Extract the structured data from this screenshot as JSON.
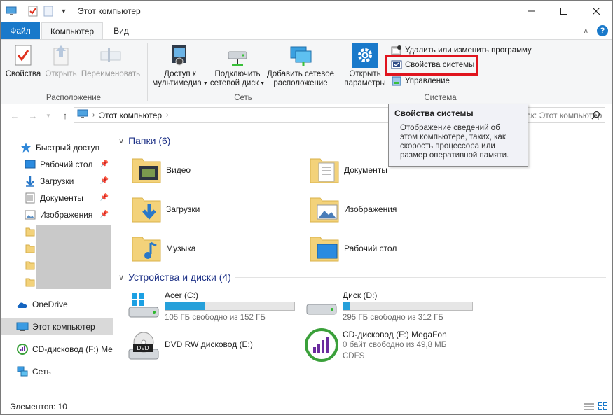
{
  "window": {
    "title": "Этот компьютер"
  },
  "tabs": {
    "file": "Файл",
    "computer": "Компьютер",
    "view": "Вид"
  },
  "ribbon": {
    "location": {
      "label": "Расположение",
      "properties": "Свойства",
      "open": "Открыть",
      "rename": "Переименовать"
    },
    "network": {
      "label": "Сеть",
      "media_line1": "Доступ к",
      "media_line2": "мультимедиа",
      "map_line1": "Подключить",
      "map_line2": "сетевой диск",
      "add_line1": "Добавить сетевое",
      "add_line2": "расположение"
    },
    "system": {
      "label": "Система",
      "open_line1": "Открыть",
      "open_line2": "параметры",
      "uninstall": "Удалить или изменить программу",
      "sysprops": "Свойства системы",
      "manage": "Управление"
    }
  },
  "address": {
    "path": "Этот компьютер",
    "search_placeholder": "рск: Этот компьютер"
  },
  "tooltip": {
    "title": "Свойства системы",
    "body_line1": "Отображение сведений об",
    "body_line2": "этом компьютере, таких, как",
    "body_line3": "скорость процессора или",
    "body_line4": "размер оперативной памяти."
  },
  "navpane": {
    "quick_access": "Быстрый доступ",
    "desktop": "Рабочий стол",
    "downloads": "Загрузки",
    "documents": "Документы",
    "pictures": "Изображения",
    "onedrive": "OneDrive",
    "this_pc": "Этот компьютер",
    "cd_drive": "CD-дисковод (F:) Me",
    "network": "Сеть"
  },
  "folders": {
    "header": "Папки (6)",
    "video": "Видео",
    "documents": "Документы",
    "downloads": "Загрузки",
    "pictures": "Изображения",
    "music": "Музыка",
    "desktop": "Рабочий стол"
  },
  "devices": {
    "header": "Устройства и диски (4)",
    "c": {
      "name": "Acer (C:)",
      "free": "105 ГБ свободно из 152 ГБ",
      "used_fraction": 0.31
    },
    "d": {
      "name": "Диск (D:)",
      "free": "295 ГБ свободно из 312 ГБ",
      "used_fraction": 0.05
    },
    "e": {
      "name": "DVD RW дисковод (E:)",
      "badge": "DVD"
    },
    "f": {
      "name": "CD-дисковод (F:) MegaFon",
      "free": "0 байт свободно из 49,8 МБ",
      "fs": "CDFS"
    }
  },
  "status": {
    "items": "Элементов: 10"
  },
  "colors": {
    "accent": "#1979ca",
    "highlight": "#e0141e",
    "bar_fill": "#26a0da",
    "selected": "#d9d9d9"
  }
}
